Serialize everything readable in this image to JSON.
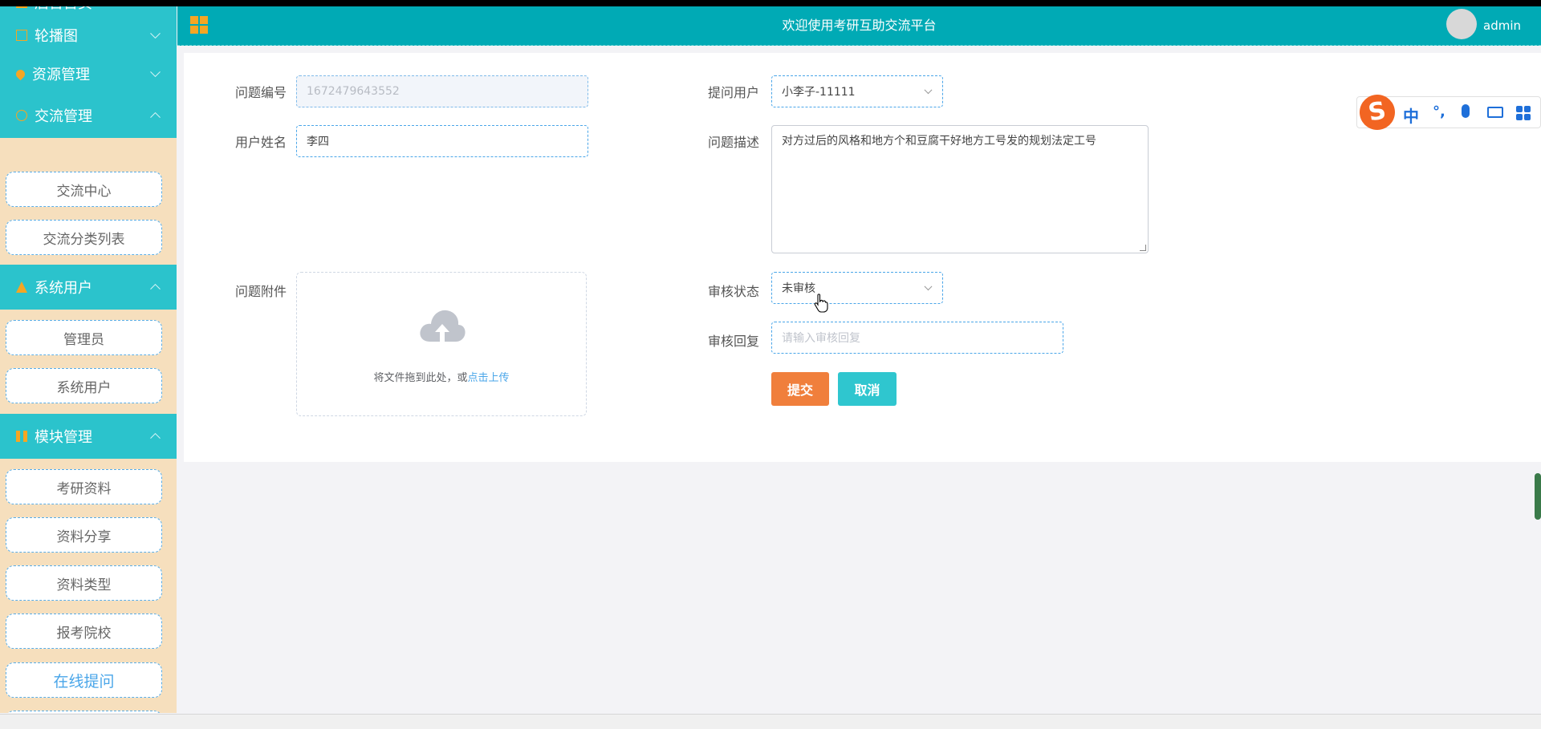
{
  "topbar": {
    "title": "欢迎使用考研互助交流平台",
    "username": "admin"
  },
  "sidebar": {
    "partial_top_label": "后台首页",
    "groups": [
      {
        "label": "轮播图",
        "icon": "image-icon",
        "expanded": false
      },
      {
        "label": "资源管理",
        "icon": "location-pin-icon",
        "expanded": false
      },
      {
        "label": "交流管理",
        "icon": "chat-icon",
        "expanded": true,
        "items": [
          "交流中心",
          "交流分类列表"
        ]
      },
      {
        "label": "系统用户",
        "icon": "user-icon",
        "expanded": true,
        "items": [
          "管理员",
          "系统用户"
        ]
      },
      {
        "label": "模块管理",
        "icon": "module-icon",
        "expanded": true,
        "items": [
          "考研资料",
          "资料分享",
          "资料类型",
          "报考院校",
          "在线提问"
        ]
      }
    ],
    "active_item": "在线提问"
  },
  "form": {
    "question_no": {
      "label": "问题编号",
      "value": "1672479643552"
    },
    "asker": {
      "label": "提问用户",
      "value": "小李子-11111"
    },
    "user_name": {
      "label": "用户姓名",
      "value": "李四"
    },
    "description": {
      "label": "问题描述",
      "value": "对方过后的风格和地方个和豆腐干好地方工号发的规划法定工号"
    },
    "attachment": {
      "label": "问题附件",
      "text": "将文件拖到此处，或",
      "link": "点击上传"
    },
    "audit_status": {
      "label": "审核状态",
      "value": "未审核"
    },
    "audit_reply": {
      "label": "审核回复",
      "placeholder": "请输入审核回复"
    },
    "submit_label": "提交",
    "cancel_label": "取消"
  },
  "ime": {
    "label": "中"
  },
  "colors": {
    "accent": "#2bc3cc",
    "topbar": "#00aab5",
    "submit": "#f07f3c",
    "cancel": "#2fc6cf"
  }
}
